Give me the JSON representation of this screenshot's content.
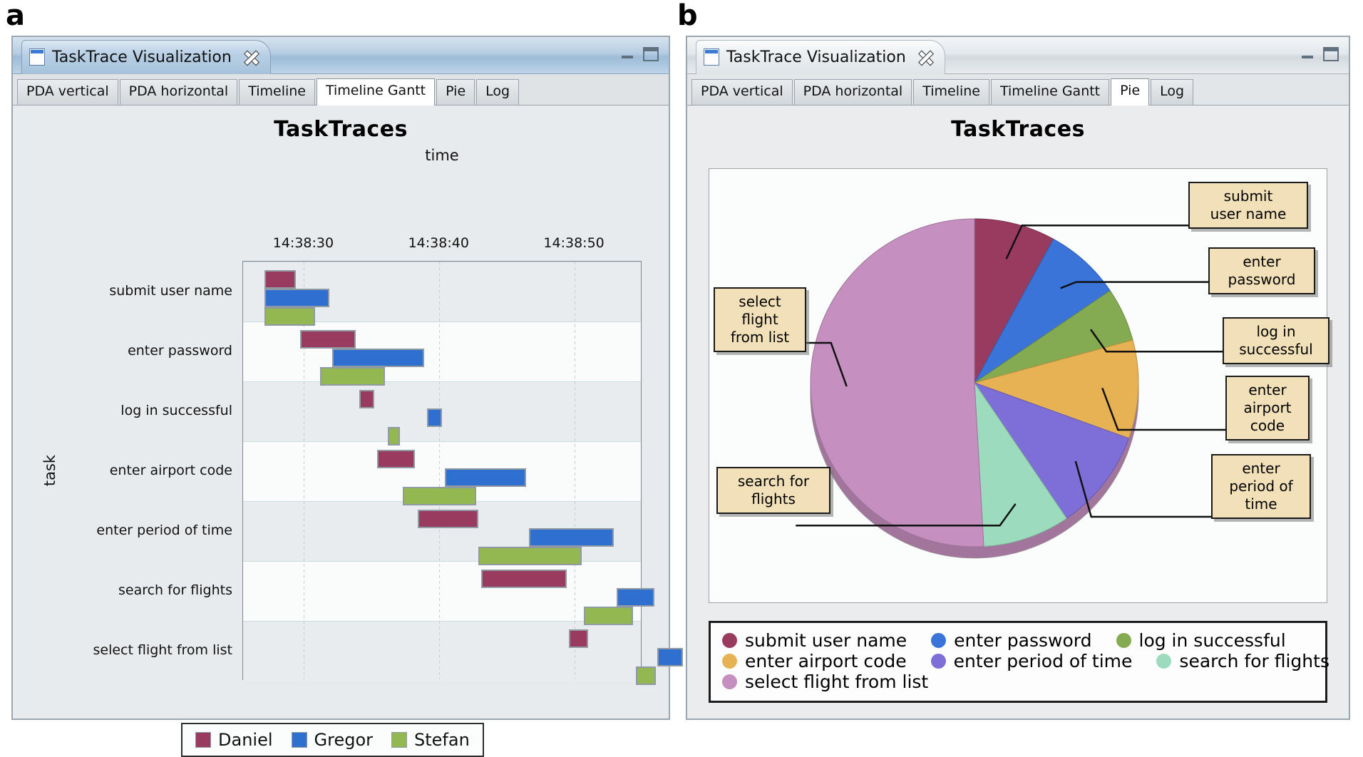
{
  "panels": {
    "a_letter": "a",
    "b_letter": "b"
  },
  "window": {
    "title": "TaskTrace Visualization",
    "icons": {
      "doc": "document-icon",
      "close": "close-icon",
      "minimize": "minimize-icon",
      "maximize": "maximize-icon"
    },
    "tabs": [
      "PDA vertical",
      "PDA horizontal",
      "Timeline",
      "Timeline Gantt",
      "Pie",
      "Log"
    ],
    "active_tab_a": "Timeline Gantt",
    "active_tab_b": "Pie"
  },
  "colors": {
    "daniel": "#993b5e",
    "gregor": "#2e6fd0",
    "stefan": "#93b851",
    "pie_submit_user_name": "#993b5e",
    "pie_enter_password": "#3a74d8",
    "pie_log_in_successful": "#85ab52",
    "pie_enter_airport_code": "#e6b253",
    "pie_enter_period_of_time": "#7e6fd8",
    "pie_search_for_flights": "#9cdcbd",
    "pie_select_flight_from_list": "#c58fc0",
    "callout_bg": "#f2e0b8",
    "plot_bg": "#f7f9fa"
  },
  "chart_data": [
    {
      "type": "bar",
      "subtype": "gantt",
      "title": "TaskTraces",
      "xlabel": "time",
      "ylabel": "task",
      "grid": true,
      "xticks": [
        "14:38:30",
        "14:38:40",
        "14:38:50"
      ],
      "xtick_seconds": [
        30,
        40,
        50
      ],
      "xlim_seconds": [
        25.5,
        55.0
      ],
      "categories": [
        "submit user name",
        "enter password",
        "log in successful",
        "enter airport code",
        "enter period of time",
        "search for flights",
        "select flight from list"
      ],
      "legend": [
        "Daniel",
        "Gregor",
        "Stefan"
      ],
      "legend_position": "bottom",
      "bars": [
        {
          "task": "submit user name",
          "user": "Daniel",
          "start": 27.1,
          "end": 29.4
        },
        {
          "task": "submit user name",
          "user": "Gregor",
          "start": 27.1,
          "end": 31.9
        },
        {
          "task": "submit user name",
          "user": "Stefan",
          "start": 27.1,
          "end": 30.8
        },
        {
          "task": "enter password",
          "user": "Daniel",
          "start": 29.7,
          "end": 33.8
        },
        {
          "task": "enter password",
          "user": "Gregor",
          "start": 32.1,
          "end": 38.9
        },
        {
          "task": "enter password",
          "user": "Stefan",
          "start": 31.2,
          "end": 36.0
        },
        {
          "task": "log in successful",
          "user": "Daniel",
          "start": 34.1,
          "end": 35.2
        },
        {
          "task": "log in successful",
          "user": "Gregor",
          "start": 39.1,
          "end": 40.2
        },
        {
          "task": "log in successful",
          "user": "Stefan",
          "start": 36.2,
          "end": 37.1
        },
        {
          "task": "enter airport code",
          "user": "Daniel",
          "start": 35.4,
          "end": 38.2
        },
        {
          "task": "enter airport code",
          "user": "Gregor",
          "start": 40.4,
          "end": 46.4
        },
        {
          "task": "enter airport code",
          "user": "Stefan",
          "start": 37.3,
          "end": 42.7
        },
        {
          "task": "enter period of time",
          "user": "Daniel",
          "start": 38.4,
          "end": 42.9
        },
        {
          "task": "enter period of time",
          "user": "Gregor",
          "start": 46.6,
          "end": 52.9
        },
        {
          "task": "enter period of time",
          "user": "Stefan",
          "start": 42.9,
          "end": 50.5
        },
        {
          "task": "search for flights",
          "user": "Daniel",
          "start": 43.1,
          "end": 49.4
        },
        {
          "task": "search for flights",
          "user": "Gregor",
          "start": 53.1,
          "end": 55.9
        },
        {
          "task": "search for flights",
          "user": "Stefan",
          "start": 50.7,
          "end": 54.3
        },
        {
          "task": "select flight from list",
          "user": "Daniel",
          "start": 49.6,
          "end": 51.0
        },
        {
          "task": "select flight from list",
          "user": "Gregor",
          "start": 56.1,
          "end": 58.0
        },
        {
          "task": "select flight from list",
          "user": "Stefan",
          "start": 54.5,
          "end": 56.0
        }
      ]
    },
    {
      "type": "pie",
      "title": "TaskTraces",
      "legend_position": "bottom",
      "labels": [
        "submit user name",
        "enter password",
        "log in successful",
        "enter airport code",
        "enter period of time",
        "search for flights",
        "select flight from list"
      ],
      "values": [
        8.0,
        7.5,
        5.3,
        9.7,
        10.0,
        8.6,
        50.9
      ],
      "unit": "percent",
      "start_angle_deg": -90,
      "callouts": [
        "submit\nuser name",
        "enter\npassword",
        "log in\nsuccessful",
        "enter\nairport\ncode",
        "enter\nperiod of\ntime",
        "search for\nflights",
        "select\nflight\nfrom list"
      ]
    }
  ],
  "gantt_legend": [
    {
      "label": "Daniel",
      "color": "#993b5e"
    },
    {
      "label": "Gregor",
      "color": "#2e6fd0"
    },
    {
      "label": "Stefan",
      "color": "#93b851"
    }
  ],
  "pie_legend": [
    {
      "label": "submit user name",
      "color": "#993b5e"
    },
    {
      "label": "enter password",
      "color": "#3a74d8"
    },
    {
      "label": "log in successful",
      "color": "#85ab52"
    },
    {
      "label": "enter airport code",
      "color": "#e6b253"
    },
    {
      "label": "enter period of time",
      "color": "#7e6fd8"
    },
    {
      "label": "search for flights",
      "color": "#9cdcbd"
    },
    {
      "label": "select flight from list",
      "color": "#c58fc0"
    }
  ]
}
